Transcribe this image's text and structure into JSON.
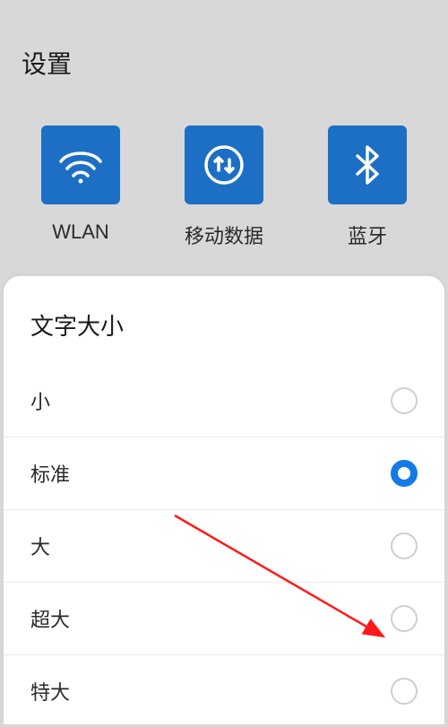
{
  "header": {
    "title": "设置"
  },
  "tiles": [
    {
      "icon": "wifi-icon",
      "label": "WLAN"
    },
    {
      "icon": "data-icon",
      "label": "移动数据"
    },
    {
      "icon": "bluetooth-icon",
      "label": "蓝牙"
    }
  ],
  "panel": {
    "title": "文字大小",
    "options": [
      {
        "label": "小",
        "selected": false
      },
      {
        "label": "标准",
        "selected": true
      },
      {
        "label": "大",
        "selected": false
      },
      {
        "label": "超大",
        "selected": false
      },
      {
        "label": "特大",
        "selected": false
      }
    ]
  },
  "colors": {
    "tile_bg": "#1c6fc4",
    "accent": "#1579e6",
    "annotation": "#ff1a1a"
  }
}
